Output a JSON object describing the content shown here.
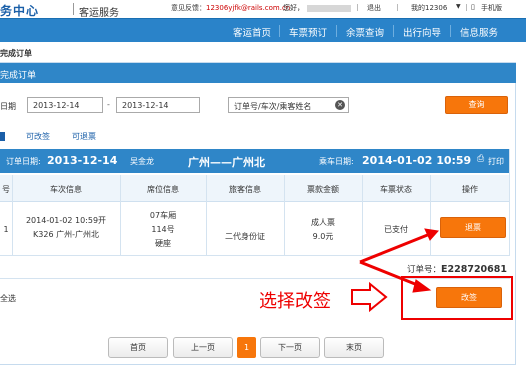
{
  "header": {
    "logo_text": "务中心",
    "logo_sub": "客运服务",
    "feedback_label": "意见反馈：",
    "feedback_email": "12306yjfk@rails.com.cn",
    "greeting": "您好，",
    "logout": "退出",
    "my12306": "我的12306",
    "mobile": "手机版"
  },
  "nav": {
    "items": [
      "客运首页",
      "车票预订",
      "余票查询",
      "出行向导",
      "信息服务"
    ]
  },
  "page": {
    "title": "完成订单",
    "panel_title": "完成订单"
  },
  "filter": {
    "date_label": "日期",
    "start_date": "2013-12-14",
    "end_date": "2013-12-14",
    "separator": "-",
    "search_placeholder": "订单号/车次/乘客姓名",
    "query_button": "查询"
  },
  "subtabs": [
    "可改签",
    "可退票"
  ],
  "order": {
    "order_date_label": "订单日期:",
    "order_date": "2013-12-14",
    "passenger": "吴金龙",
    "route": "广州——广州北",
    "ride_date_label": "乘车日期:",
    "ride_date": "2014-01-02 10:59",
    "print": "打印"
  },
  "table": {
    "headers": [
      "号",
      "车次信息",
      "席位信息",
      "旅客信息",
      "票款金额",
      "车票状态",
      "操作"
    ],
    "row": {
      "index": "1",
      "train_line1": "2014-01-02 10:59开",
      "train_line2": "K326 广州-广州北",
      "seat_line1": "07车厢",
      "seat_line2": "114号",
      "seat_line3": "硬座",
      "passenger_id_type": "二代身份证",
      "fare_line1": "成人票",
      "fare_line2": "9.0元",
      "status": "已支付",
      "refund_button": "退票"
    }
  },
  "footer": {
    "order_no_label": "订单号：",
    "order_no": "E228720681",
    "select_all": "全选",
    "change_button": "改签",
    "annotation": "选择改签"
  },
  "pager": {
    "first": "首页",
    "prev": "上一页",
    "current": "1",
    "next": "下一页",
    "last": "末页"
  },
  "colors": {
    "nav_blue": "#2a83c9",
    "button_orange": "#f7760b",
    "annotation_red": "#e00000"
  }
}
